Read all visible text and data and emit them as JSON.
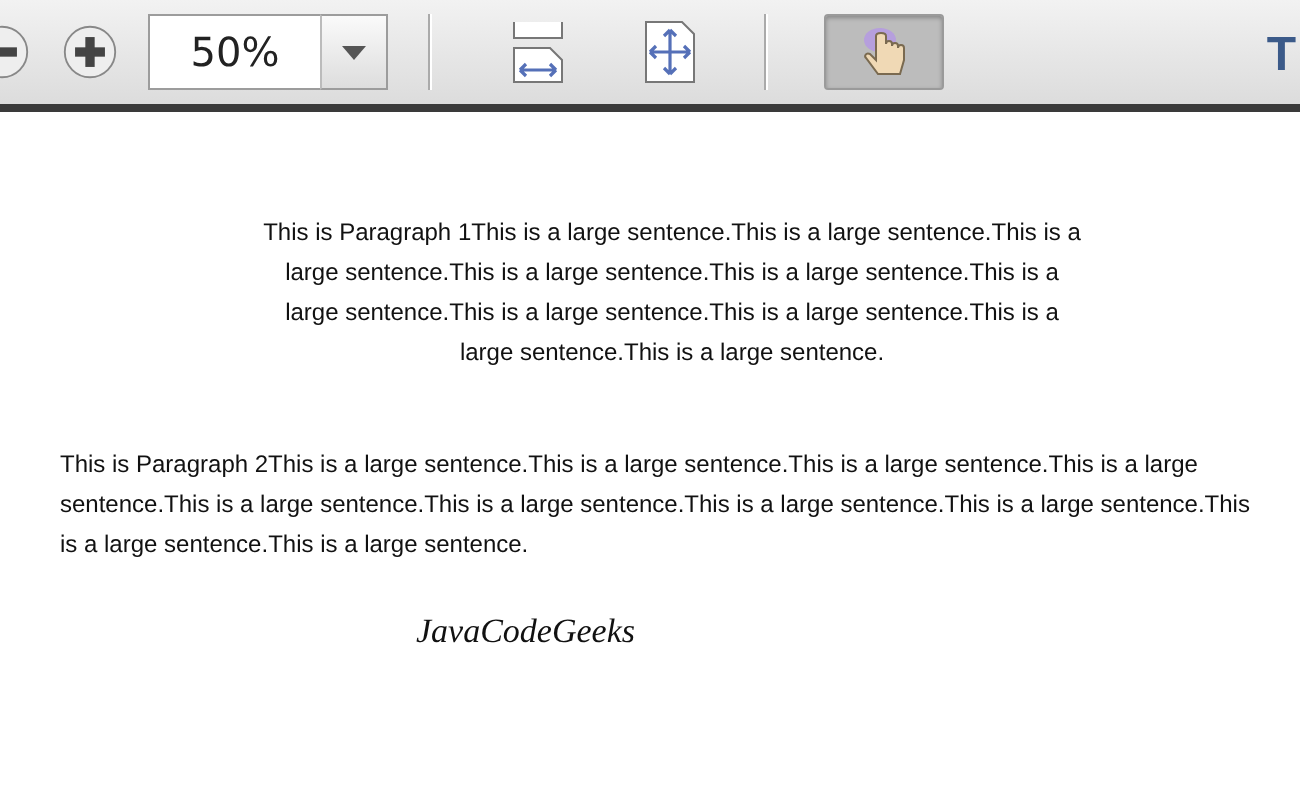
{
  "toolbar": {
    "tools": [
      {
        "kind": "zoom-out",
        "selected": false
      },
      {
        "kind": "zoom-in",
        "selected": false
      },
      {
        "kind": "zoom-field",
        "value": "50%"
      },
      {
        "kind": "separator"
      },
      {
        "kind": "fit-width",
        "selected": false
      },
      {
        "kind": "fit-page",
        "selected": false
      },
      {
        "kind": "separator"
      },
      {
        "kind": "hand",
        "selected": true
      }
    ],
    "right_label": "T"
  },
  "document": {
    "paragraphs": [
      {
        "kind": "centered",
        "text": "This is Paragraph 1This is a large sentence.This is a large sentence.This is a large sentence.This is a large sentence.This is a large sentence.This is a large sentence.This is a large sentence.This is a large sentence.This is a large sentence.This is a large sentence."
      },
      {
        "kind": "full",
        "text": "This is Paragraph 2This is a large sentence.This is a large sentence.This is a large sentence.This is a large sentence.This is a large sentence.This is a large sentence.This is a large sentence.This is a large sentence.This is a large sentence.This is a large sentence."
      }
    ],
    "signature": "JavaCodeGeeks"
  }
}
